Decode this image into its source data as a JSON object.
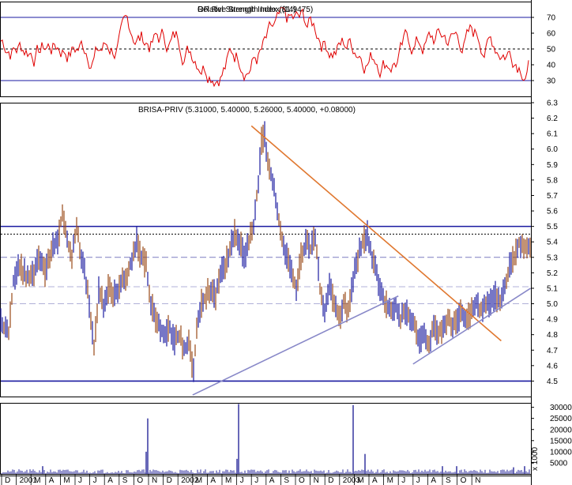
{
  "chart_data": [
    {
      "type": "line",
      "panel": "rsi",
      "title": "Relative Strength Index (14)",
      "title_overlay": "OR Rel Strength Index (81.9475)",
      "ylim": [
        20,
        80
      ],
      "yticks": [
        30,
        40,
        50,
        60,
        70
      ],
      "guides": [
        70,
        50,
        30
      ],
      "series_color": "#e00000"
    },
    {
      "type": "line",
      "panel": "price",
      "title": "BRISA-PRIV (5.31000, 5.40000, 5.26000, 5.40000, +0.08000)",
      "ylim": [
        4.4,
        6.3
      ],
      "yticks": [
        "4.5",
        "4.6",
        "4.7",
        "4.8",
        "4.9",
        "5.0",
        "5.1",
        "5.2",
        "5.3",
        "5.4",
        "5.5",
        "5.6",
        "5.7",
        "5.8",
        "5.9",
        "6.0",
        "6.1",
        "6.2",
        "6.3"
      ],
      "horizontal_lines": [
        {
          "value": 5.5,
          "style": "solid",
          "color": "#1a1aa0"
        },
        {
          "value": 5.45,
          "style": "dotted",
          "color": "#000000"
        },
        {
          "value": 5.3,
          "style": "dashed",
          "color": "#7a7ac0"
        },
        {
          "value": 5.11,
          "style": "dashed",
          "color": "#b0b0d8"
        },
        {
          "value": 5.0,
          "style": "dashed",
          "color": "#b0b0d8"
        },
        {
          "value": 4.5,
          "style": "solid",
          "color": "#1a1aa0"
        }
      ],
      "trendlines": [
        {
          "color": "#e07830",
          "from": [
            "2002-05",
            6.15
          ],
          "to": [
            "2003-10",
            4.76
          ]
        },
        {
          "color": "#8888c8",
          "from": [
            "2002-01",
            4.41
          ],
          "to": [
            "2003-03",
            5.05
          ]
        },
        {
          "color": "#8888c8",
          "from": [
            "2003-04",
            4.61
          ],
          "to": [
            "2003-12",
            5.1
          ]
        }
      ],
      "path": [
        [
          0,
          4.9
        ],
        [
          4,
          4.85
        ],
        [
          10,
          4.8
        ],
        [
          16,
          5.15
        ],
        [
          22,
          5.25
        ],
        [
          30,
          5.2
        ],
        [
          36,
          5.15
        ],
        [
          42,
          5.2
        ],
        [
          48,
          5.3
        ],
        [
          56,
          5.2
        ],
        [
          64,
          5.35
        ],
        [
          72,
          5.4
        ],
        [
          78,
          5.6
        ],
        [
          84,
          5.4
        ],
        [
          90,
          5.3
        ],
        [
          96,
          5.5
        ],
        [
          102,
          5.3
        ],
        [
          106,
          5.2
        ],
        [
          112,
          5.0
        ],
        [
          118,
          4.7
        ],
        [
          124,
          5.1
        ],
        [
          130,
          5.0
        ],
        [
          136,
          5.1
        ],
        [
          142,
          5.05
        ],
        [
          148,
          5.1
        ],
        [
          154,
          5.15
        ],
        [
          160,
          5.2
        ],
        [
          166,
          5.3
        ],
        [
          172,
          5.4
        ],
        [
          178,
          5.3
        ],
        [
          184,
          5.25
        ],
        [
          190,
          5.0
        ],
        [
          196,
          4.9
        ],
        [
          202,
          4.85
        ],
        [
          208,
          4.8
        ],
        [
          214,
          4.85
        ],
        [
          220,
          4.75
        ],
        [
          226,
          4.8
        ],
        [
          232,
          4.7
        ],
        [
          238,
          4.75
        ],
        [
          244,
          4.55
        ],
        [
          248,
          4.85
        ],
        [
          254,
          5.0
        ],
        [
          260,
          5.05
        ],
        [
          266,
          5.1
        ],
        [
          272,
          5.05
        ],
        [
          278,
          5.2
        ],
        [
          284,
          5.25
        ],
        [
          290,
          5.35
        ],
        [
          296,
          5.45
        ],
        [
          302,
          5.4
        ],
        [
          308,
          5.3
        ],
        [
          314,
          5.4
        ],
        [
          320,
          5.5
        ],
        [
          326,
          5.8
        ],
        [
          330,
          6.05
        ],
        [
          334,
          6.1
        ],
        [
          338,
          5.9
        ],
        [
          344,
          5.8
        ],
        [
          350,
          5.6
        ],
        [
          356,
          5.4
        ],
        [
          362,
          5.3
        ],
        [
          368,
          5.2
        ],
        [
          374,
          5.1
        ],
        [
          380,
          5.3
        ],
        [
          386,
          5.4
        ],
        [
          392,
          5.35
        ],
        [
          398,
          5.45
        ],
        [
          404,
          5.1
        ],
        [
          410,
          4.95
        ],
        [
          416,
          5.1
        ],
        [
          422,
          5.0
        ],
        [
          428,
          4.9
        ],
        [
          434,
          5.0
        ],
        [
          440,
          4.95
        ],
        [
          446,
          5.15
        ],
        [
          452,
          5.3
        ],
        [
          458,
          5.4
        ],
        [
          464,
          5.45
        ],
        [
          470,
          5.3
        ],
        [
          476,
          5.2
        ],
        [
          482,
          5.05
        ],
        [
          488,
          5.0
        ],
        [
          494,
          4.95
        ],
        [
          500,
          5.0
        ],
        [
          506,
          4.9
        ],
        [
          512,
          4.95
        ],
        [
          518,
          4.9
        ],
        [
          524,
          4.85
        ],
        [
          530,
          4.75
        ],
        [
          536,
          4.8
        ],
        [
          542,
          4.75
        ],
        [
          548,
          4.85
        ],
        [
          554,
          4.8
        ],
        [
          560,
          4.85
        ],
        [
          566,
          4.9
        ],
        [
          572,
          4.85
        ],
        [
          578,
          4.9
        ],
        [
          584,
          4.95
        ],
        [
          590,
          4.9
        ],
        [
          596,
          4.95
        ],
        [
          602,
          5.0
        ],
        [
          608,
          4.95
        ],
        [
          614,
          5.0
        ],
        [
          620,
          5.0
        ],
        [
          626,
          5.05
        ],
        [
          632,
          5.0
        ],
        [
          638,
          5.1
        ],
        [
          644,
          5.25
        ],
        [
          650,
          5.3
        ],
        [
          656,
          5.4
        ],
        [
          662,
          5.35
        ],
        [
          668,
          5.38
        ],
        [
          672,
          5.4
        ]
      ]
    },
    {
      "type": "bar",
      "panel": "volume",
      "ylabel": "x 1000",
      "ylim": [
        0,
        32000
      ],
      "yticks": [
        "5000",
        "10000",
        "15000",
        "20000",
        "25000",
        "30000"
      ],
      "spikes": [
        [
          54,
          3500
        ],
        [
          185,
          10000
        ],
        [
          187,
          25000
        ],
        [
          302,
          31500
        ],
        [
          300,
          6800
        ],
        [
          447,
          31000
        ],
        [
          462,
          9000
        ],
        [
          560,
          3500
        ],
        [
          578,
          3500
        ],
        [
          650,
          3000
        ],
        [
          664,
          3500
        ]
      ]
    }
  ],
  "x_axis": {
    "labels": [
      "D",
      "2001",
      "M",
      "A",
      "M",
      "J",
      "J",
      "A",
      "S",
      "O",
      "N",
      "D",
      "2002",
      "M",
      "A",
      "M",
      "J",
      "J",
      "A",
      "S",
      "O",
      "N",
      "D",
      "2003",
      "M",
      "A",
      "M",
      "J",
      "J",
      "A",
      "S",
      "O",
      "N"
    ]
  }
}
